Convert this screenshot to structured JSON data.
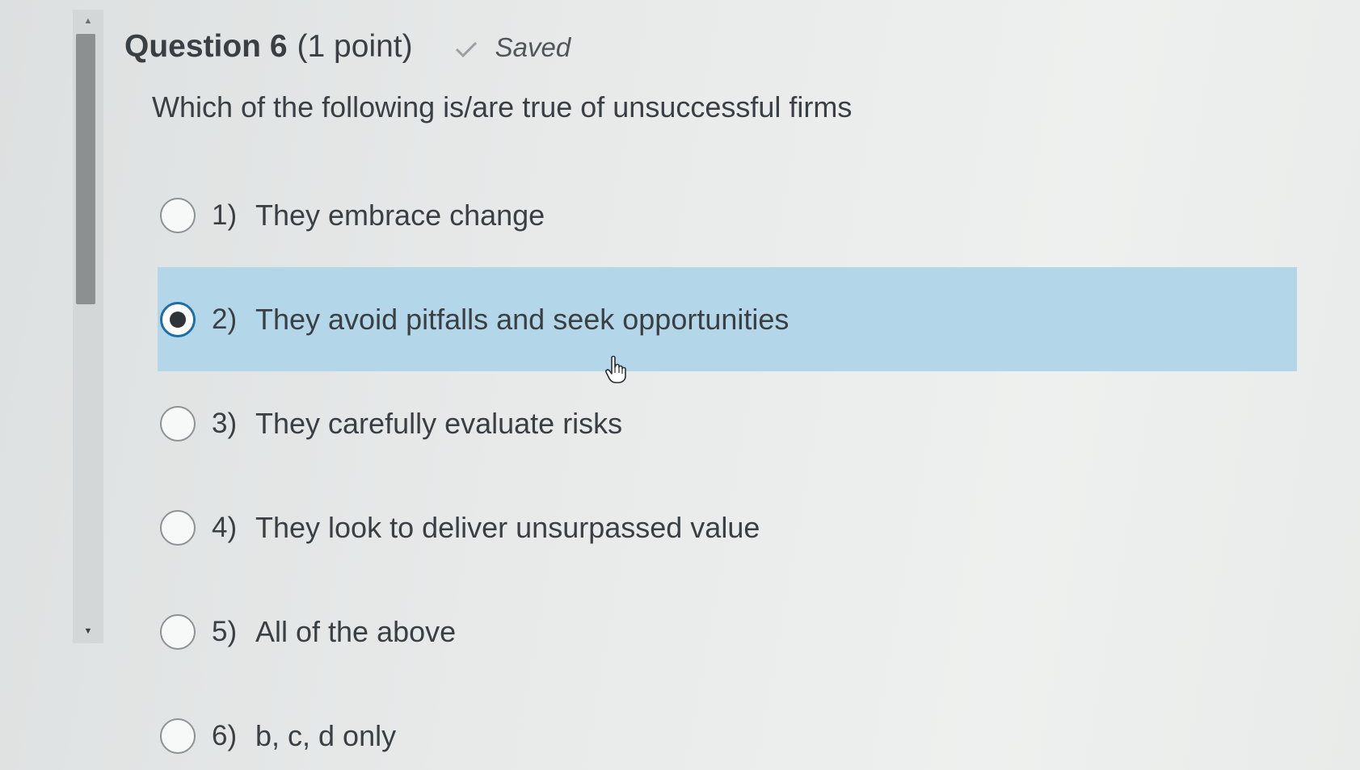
{
  "question": {
    "title": "Question 6",
    "points": "(1 point)",
    "status": "Saved",
    "prompt": "Which of the following is/are true of unsuccessful firms"
  },
  "options": [
    {
      "number": "1)",
      "label": "They embrace change",
      "selected": false
    },
    {
      "number": "2)",
      "label": "They avoid pitfalls and seek opportunities",
      "selected": true
    },
    {
      "number": "3)",
      "label": "They carefully evaluate risks",
      "selected": false
    },
    {
      "number": "4)",
      "label": "They look to deliver unsurpassed value",
      "selected": false
    },
    {
      "number": "5)",
      "label": "All of the above",
      "selected": false
    },
    {
      "number": "6)",
      "label": "b, c, d only",
      "selected": false
    }
  ],
  "icons": {
    "saved": "checkmark-icon",
    "cursor": "hand-pointer-icon",
    "scroll_up": "triangle-up-icon",
    "scroll_down": "triangle-down-icon"
  },
  "colors": {
    "selected_background": "#b3d7e9",
    "selected_radio_border": "#1e6fa8"
  }
}
